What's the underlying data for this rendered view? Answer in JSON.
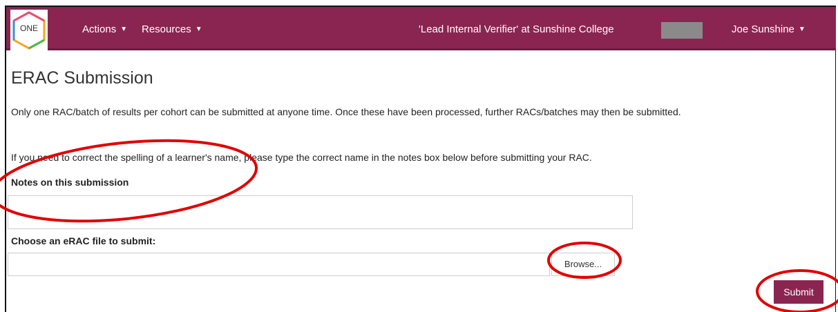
{
  "navbar": {
    "logo_text": "ONE",
    "actions_label": "Actions",
    "resources_label": "Resources",
    "role_text": "'Lead Internal Verifier' at Sunshine College",
    "user_label": "Joe Sunshine",
    "colors": {
      "brand": "#8a2551"
    }
  },
  "page": {
    "title": "ERAC Submission",
    "paragraph1": "Only one RAC/batch of results per cohort can be submitted at anyone time.  Once these have been processed, further RACs/batches may then be submitted.",
    "paragraph2": "If you need to correct the spelling of a learner's name, please type the correct name in the notes box below before submitting your RAC.",
    "notes_label": "Notes on this submission",
    "notes_value": "",
    "file_label": "Choose an eRAC file to submit:",
    "file_value": "",
    "browse_label": "Browse...",
    "submit_label": "Submit"
  },
  "annotations": {
    "circle_color": "#e00000"
  }
}
